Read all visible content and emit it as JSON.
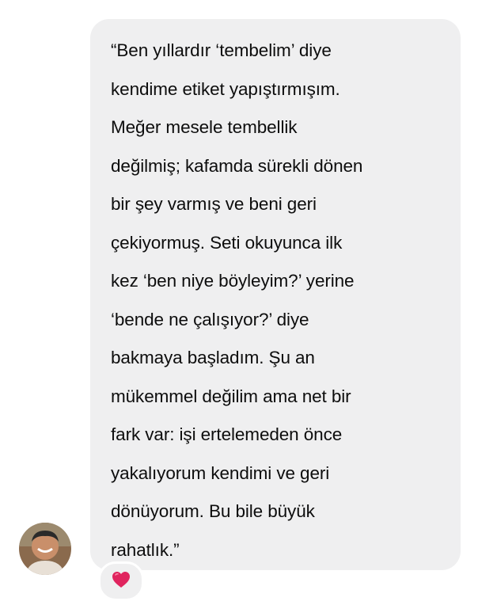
{
  "message": {
    "text": "“Ben yıllardır ‘tembelim’ diye\nkendime etiket yapıştırmışım.\nMeğer mesele tembellik\ndeğilmiş; kafamda sürekli dönen\nbir şey varmış ve beni geri\nçekiyormuş. Seti okuyunca ilk\nkez ‘ben niye böyleyim?’ yerine\n‘bende ne çalışıyor?’ diye\nbakmaya başladım. Şu an\nmükemmel değilim ama net bir\nfark var: işi ertelemeden önce\nyakalıyorum kendimi ve geri\ndönüyorum. Bu bile büyük\nrahatlık.”"
  },
  "reaction": {
    "icon": "heart-icon",
    "color": "#e0245e"
  },
  "colors": {
    "bubble": "#efeff0",
    "text": "#0d0d0d",
    "background": "#ffffff"
  }
}
